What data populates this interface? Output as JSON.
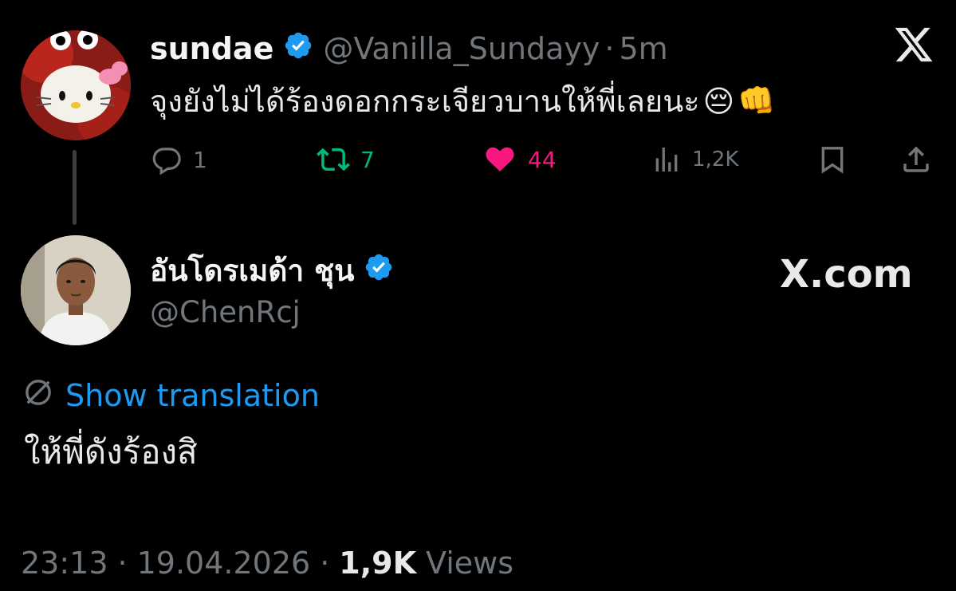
{
  "colors": {
    "background": "#000000",
    "text": "#e7e9ea",
    "muted": "#71767b",
    "verified": "#1d9bf0",
    "retweet": "#00ba7c",
    "like": "#f91880",
    "link": "#1d9bf0"
  },
  "parent_tweet": {
    "display_name": "sundae",
    "handle": "@Vanilla_Sundayy",
    "separator": "·",
    "time": "5m",
    "text": "จุงยังไม่ได้ร้องดอกกระเจียวบานให้พี่เลยนะ",
    "emoji_1": "😔",
    "emoji_2": "👊",
    "icons": [
      "verified-badge-icon",
      "x-logo-icon"
    ],
    "actions": {
      "replies": "1",
      "retweets": "7",
      "likes": "44",
      "views": "1,2K"
    }
  },
  "reply_tweet": {
    "display_name": "อันโดรเมด้า ชุน",
    "handle": "@ChenRcj",
    "watermark": "X.com",
    "show_translation": "Show translation",
    "text": "ให้พี่ดังร้องสิ",
    "timestamp": "23:13",
    "separator": "·",
    "date": "19.04.2026",
    "views_count": "1,9K",
    "views_label": "Views"
  }
}
